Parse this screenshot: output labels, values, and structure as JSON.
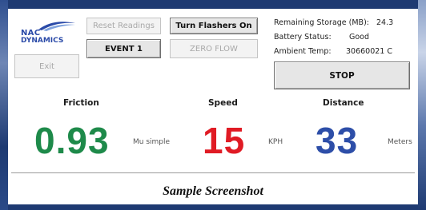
{
  "logo": {
    "line1": "NAC",
    "line2": "DYNAMICS"
  },
  "buttons": {
    "reset_readings": "Reset Readings",
    "turn_flashers_on": "Turn Flashers On",
    "event": "EVENT 1",
    "zero_flow": "ZERO FLOW",
    "exit": "Exit",
    "stop": "STOP"
  },
  "status": {
    "storage_label": "Remaining Storage (MB):",
    "storage_value": "24.3",
    "battery_label": "Battery Status:",
    "battery_value": "Good",
    "temp_label": "Ambient Temp:",
    "temp_value": "30660021 C"
  },
  "metrics": {
    "friction": {
      "label": "Friction",
      "value": "0.93",
      "unit": "Mu simple",
      "color": "#1e8a4a"
    },
    "speed": {
      "label": "Speed",
      "value": "15",
      "unit": "KPH",
      "color": "#e01b24"
    },
    "distance": {
      "label": "Distance",
      "value": "33",
      "unit": "Meters",
      "color": "#2d4ea8"
    }
  },
  "caption": "Sample Screenshot",
  "colors": {
    "frame": "#1e3a72",
    "logo_blue": "#2a4aa8"
  }
}
